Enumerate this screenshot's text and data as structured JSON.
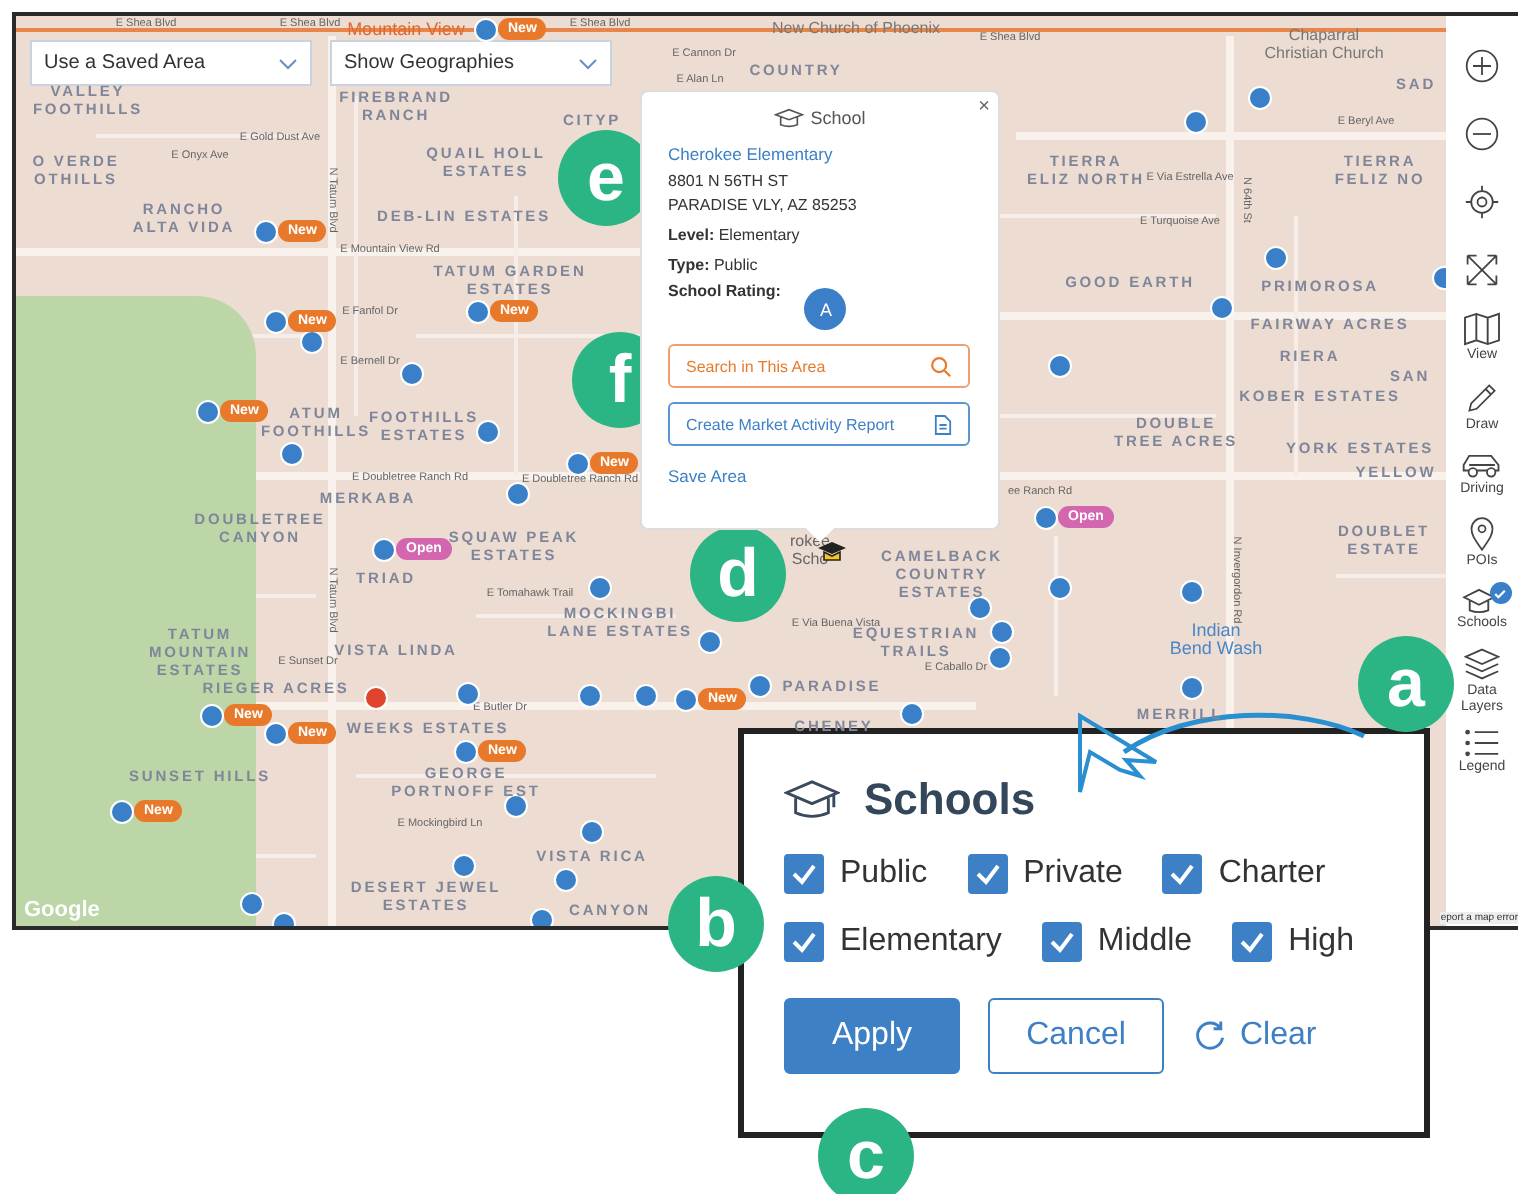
{
  "map": {
    "dropdowns": [
      {
        "label": "Use a Saved Area"
      },
      {
        "label": "Show Geographies"
      }
    ],
    "places": [
      {
        "label": "Mountain View",
        "kind": "poi"
      },
      {
        "label": "New Church of Phoenix",
        "kind": "church"
      },
      {
        "label": "Chaparral\nChristian Church",
        "kind": "church"
      },
      {
        "label": "Indian\nBend Wash",
        "kind": "water"
      },
      {
        "label": "rokee\nScho",
        "kind": "school"
      }
    ],
    "area_labels": [
      "VALLEY\nFOOTHILLS",
      "O VERDE\nOTHILLS",
      "FIREBRAND\nRANCH",
      "COUNTRY",
      "CITYP",
      "RANCHO\nALTA VIDA",
      "QUAIL HOLL\nESTATES",
      "DEB-LIN ESTATES",
      "TATUM GARDEN\nESTATES",
      "ATUM\nFOOTHILLS",
      "FOOTHILLS\nESTATES",
      "MERKABA",
      "DOUBLETREE\nCANYON",
      "SQUAW PEAK\nESTATES",
      "TRIAD",
      "MOCKINGBI\nLANE ESTATES",
      "TATUM\nMOUNTAIN\nESTATES",
      "VISTA LINDA",
      "RIEGER ACRES",
      "WEEKS ESTATES",
      "SUNSET HILLS",
      "GEORGE\nPORTNOFF EST",
      "VISTA RICA",
      "DESERT JEWEL\nESTATES",
      "CANYON",
      "TIERRA\nELIZ NORTH",
      "TIERRA\nFELIZ NO",
      "SAD",
      "GOOD EARTH",
      "PRIMOROSA",
      "FAIRWAY ACRES",
      "RIERA",
      "SAN",
      "KOBER ESTATES",
      "DOUBLE\nTREE ACRES",
      "YORK ESTATES",
      "YELLOW",
      "CAMELBACK\nCOUNTRY\nESTATES",
      "EQUESTRIAN\nTRAILS",
      "PARADISE",
      "CHENEY",
      "MERRILL",
      "DOUBLET\nESTATE"
    ],
    "street_labels": [
      "E Shea Blvd",
      "E Shea Blvd",
      "E Shea Blvd",
      "E Shea Blvd",
      "E Cannon Dr",
      "E Alan Ln",
      "E Gold Dust Ave",
      "E Onyx Ave",
      "N Tatum Blvd",
      "E Mountain View Rd",
      "E Fanfol Dr",
      "E Bernell Dr",
      "E Doubletree Ranch Rd",
      "E Doubletree Ranch Rd",
      "N Tatum Blvd",
      "E Tomahawk Trail",
      "E Sunset Dr",
      "E Butler Dr",
      "E Mockingbird Ln",
      "E Via Buena Vista",
      "E Caballo Dr",
      "ee Ranch Rd",
      "E Via Estrella Ave",
      "E Turquoise Ave",
      "N 64th St",
      "N Invergordon Rd",
      "E Beryl Ave"
    ],
    "pins": [
      {
        "kind": "school",
        "badge": {
          "label": "New",
          "color": "#e8792b"
        }
      },
      {
        "kind": "school",
        "badge": {
          "label": "New",
          "color": "#e8792b"
        }
      },
      {
        "kind": "school"
      },
      {
        "kind": "school",
        "badge": {
          "label": "New",
          "color": "#e8792b"
        }
      },
      {
        "kind": "school"
      },
      {
        "kind": "school",
        "badge": {
          "label": "New",
          "color": "#e8792b"
        }
      },
      {
        "kind": "school"
      },
      {
        "kind": "school"
      },
      {
        "kind": "school",
        "badge": {
          "label": "New",
          "color": "#e8792b"
        }
      },
      {
        "kind": "school",
        "badge": {
          "label": "New",
          "color": "#e8792b"
        }
      },
      {
        "kind": "school"
      },
      {
        "kind": "school",
        "badge": {
          "label": "Open",
          "color": "#d466b0"
        }
      },
      {
        "kind": "school"
      },
      {
        "kind": "school"
      },
      {
        "kind": "school"
      },
      {
        "kind": "school"
      },
      {
        "kind": "school"
      },
      {
        "kind": "school",
        "badge": {
          "label": "New",
          "color": "#e8792b"
        }
      },
      {
        "kind": "school",
        "badge": {
          "label": "New",
          "color": "#e8792b"
        }
      },
      {
        "kind": "school",
        "badge": {
          "label": "New",
          "color": "#e8792b"
        }
      },
      {
        "kind": "school",
        "badge": {
          "label": "New",
          "color": "#e8792b"
        }
      },
      {
        "kind": "school",
        "badge": {
          "label": "New",
          "color": "#e8792b"
        }
      },
      {
        "kind": "school"
      },
      {
        "kind": "school"
      },
      {
        "kind": "school"
      },
      {
        "kind": "school"
      },
      {
        "kind": "school"
      },
      {
        "kind": "school"
      },
      {
        "kind": "school"
      },
      {
        "kind": "location"
      },
      {
        "kind": "school"
      },
      {
        "kind": "school"
      },
      {
        "kind": "school"
      },
      {
        "kind": "school"
      },
      {
        "kind": "school"
      },
      {
        "kind": "school"
      },
      {
        "kind": "school",
        "badge": {
          "label": "Open",
          "color": "#d466b0"
        }
      },
      {
        "kind": "school"
      },
      {
        "kind": "school"
      },
      {
        "kind": "school"
      },
      {
        "kind": "school"
      },
      {
        "kind": "school"
      },
      {
        "kind": "school"
      },
      {
        "kind": "school"
      },
      {
        "kind": "school"
      }
    ],
    "attribution": "Google",
    "report_link": "eport a map error"
  },
  "popup": {
    "header": "School",
    "close": "×",
    "name": "Cherokee Elementary",
    "address": [
      "8801 N 56TH ST",
      "PARADISE VLY, AZ 85253"
    ],
    "fields": [
      "**Level:** Elementary",
      "**Type:** Public"
    ],
    "rating_label": "School Rating:",
    "rating": "A",
    "buttons": [
      {
        "label": "Search in This Area",
        "kind": "search"
      },
      {
        "label": "Create Market Activity Report",
        "kind": "report"
      }
    ],
    "link": "Save Area"
  },
  "tools": [
    {
      "kind": "zoom-in"
    },
    {
      "kind": "zoom-out"
    },
    {
      "kind": "locate"
    },
    {
      "kind": "expand"
    },
    {
      "kind": "view",
      "label": "View"
    },
    {
      "kind": "draw",
      "label": "Draw"
    },
    {
      "kind": "driving",
      "label": "Driving"
    },
    {
      "kind": "pois",
      "label": "POIs"
    },
    {
      "kind": "schools",
      "label": "Schools",
      "checked": true
    },
    {
      "kind": "layers",
      "label": "Data\nLayers"
    },
    {
      "kind": "legend",
      "label": "Legend"
    }
  ],
  "schools_panel": {
    "title": "Schools",
    "option_rows": [
      [
        {
          "label": "Public",
          "checked": true
        },
        {
          "label": "Private",
          "checked": true
        },
        {
          "label": "Charter",
          "checked": true
        }
      ],
      [
        {
          "label": "Elementary",
          "checked": true
        },
        {
          "label": "Middle",
          "checked": true
        },
        {
          "label": "High",
          "checked": true
        }
      ]
    ],
    "buttons": [
      {
        "label": "Apply",
        "kind": "primary"
      },
      {
        "label": "Cancel",
        "kind": "secondary"
      },
      {
        "label": "Clear",
        "kind": "reset"
      }
    ]
  },
  "callouts": [
    "a",
    "b",
    "c",
    "d",
    "e",
    "f"
  ]
}
